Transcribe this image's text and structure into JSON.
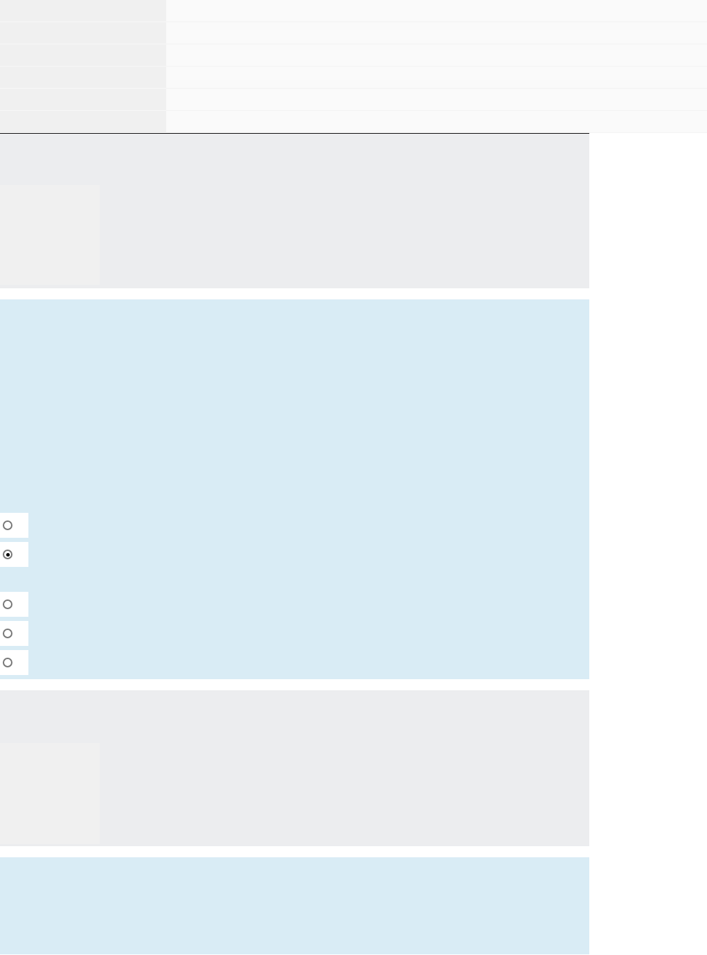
{
  "radio_groups": [
    {
      "options": [
        {
          "selected": false
        },
        {
          "selected": true
        }
      ]
    },
    {
      "options": [
        {
          "selected": false
        },
        {
          "selected": false
        },
        {
          "selected": false
        }
      ]
    }
  ]
}
